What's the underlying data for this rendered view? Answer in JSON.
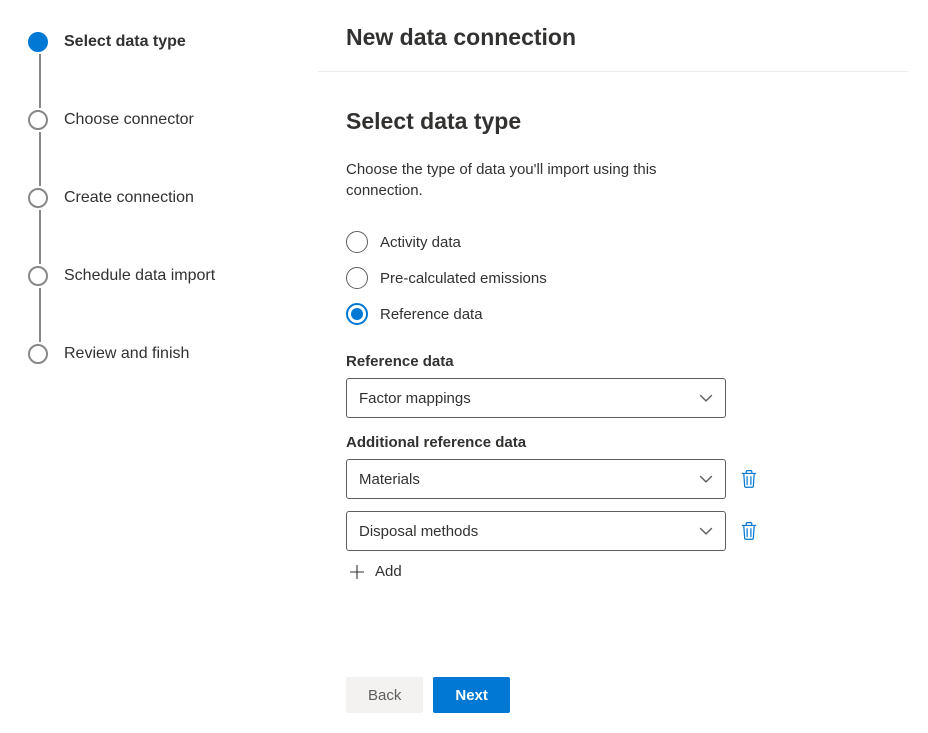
{
  "header": {
    "title": "New data connection"
  },
  "stepper": {
    "steps": [
      {
        "label": "Select data type",
        "active": true
      },
      {
        "label": "Choose connector",
        "active": false
      },
      {
        "label": "Create connection",
        "active": false
      },
      {
        "label": "Schedule data import",
        "active": false
      },
      {
        "label": "Review and finish",
        "active": false
      }
    ]
  },
  "section": {
    "title": "Select data type",
    "description": "Choose the type of data you'll import using this connection."
  },
  "radios": {
    "options": [
      {
        "label": "Activity data",
        "selected": false
      },
      {
        "label": "Pre-calculated emissions",
        "selected": false
      },
      {
        "label": "Reference data",
        "selected": true
      }
    ]
  },
  "referenceData": {
    "label": "Reference data",
    "value": "Factor mappings"
  },
  "additionalRef": {
    "label": "Additional reference data",
    "items": [
      {
        "value": "Materials"
      },
      {
        "value": "Disposal methods"
      }
    ],
    "addLabel": "Add"
  },
  "footer": {
    "back": "Back",
    "next": "Next"
  }
}
